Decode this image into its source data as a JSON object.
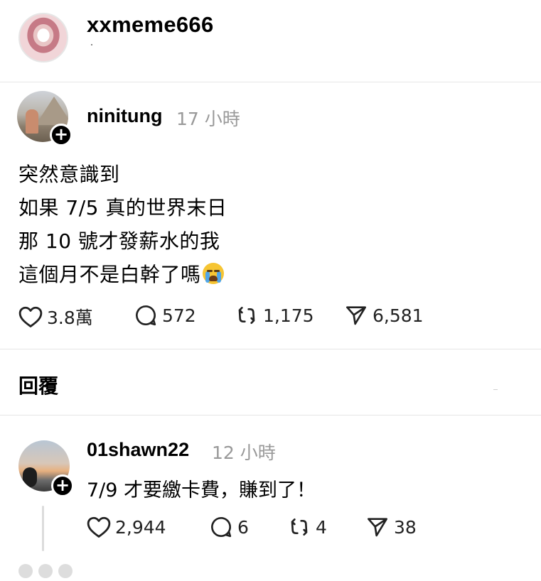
{
  "header": {
    "username": "xxmeme666"
  },
  "post": {
    "author": "ninitung",
    "time": "17 小時",
    "lines": [
      "突然意識到",
      "如果 7/5 真的世界末日",
      "那 10 號才發薪水的我",
      "這個月不是白幹了嗎"
    ],
    "emoji": "loudly-crying-face",
    "actions": {
      "likes": "3.8萬",
      "comments": "572",
      "reposts": "1,175",
      "shares": "6,581"
    }
  },
  "reply_section": {
    "title": "回覆"
  },
  "reply": {
    "author": "01shawn22",
    "time": "12 小時",
    "text": "7/9 才要繳卡費，賺到了！",
    "actions": {
      "likes": "2,944",
      "comments": "6",
      "reposts": "4",
      "shares": "38"
    }
  },
  "icons": {
    "like": "heart-icon",
    "comment": "comment-bubble-icon",
    "repost": "repost-arrows-icon",
    "share": "send-arrow-icon",
    "follow": "plus-icon"
  }
}
